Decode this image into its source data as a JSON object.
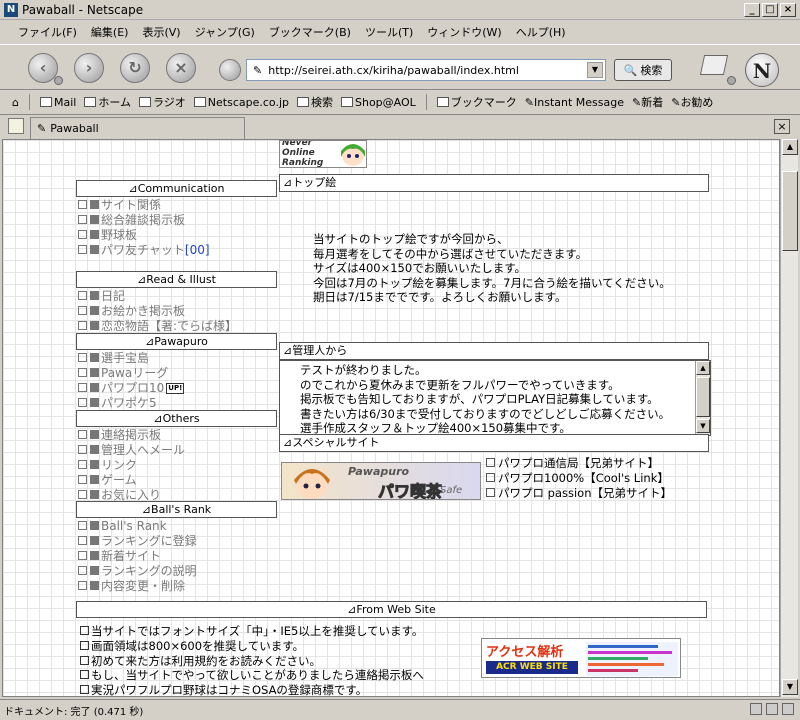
{
  "window": {
    "title": "Pawaball - Netscape",
    "app_icon": "N",
    "buttons": [
      "_",
      "□",
      "×"
    ]
  },
  "menu": [
    "ファイル(F)",
    "編集(E)",
    "表示(V)",
    "ジャンプ(G)",
    "ブックマーク(B)",
    "ツール(T)",
    "ウィンドウ(W)",
    "ヘルプ(H)"
  ],
  "nav": {
    "url": "http://seirei.ath.cx/kiriha/pawaball/index.html",
    "search_label": "検索",
    "logo": "N"
  },
  "personal_toolbar": [
    "Mail",
    "ホーム",
    "ラジオ",
    "Netscape.co.jp",
    "検索",
    "Shop@AOL",
    "ブックマーク",
    "Instant Message",
    "新着",
    "お勧め"
  ],
  "tab": {
    "label": "Pawaball",
    "close": "×"
  },
  "page": {
    "ranking_banner": {
      "line1": "Never",
      "line2": "Online",
      "line3": "Ranking"
    },
    "sections": {
      "communication": "⊿Communication",
      "read_illust": "⊿Read & Illust",
      "pawapuro": "⊿Pawapuro",
      "others": "⊿Others",
      "balls_rank": "⊿Ball's Rank",
      "from_web": "⊿From Web Site",
      "top_e": "⊿トップ絵",
      "admin": "⊿管理人から",
      "special": "⊿スペシャルサイト"
    },
    "communication_items": [
      "サイト関係",
      "総合雑談掲示板",
      "野球板",
      "パワ友チャット"
    ],
    "chat_suffix": "[00]",
    "read_items": [
      "日記",
      "お絵かき掲示板",
      "恋恋物語【著:でらば様】"
    ],
    "pawapuro_items": [
      "選手宝島",
      "Pawaリーグ",
      "パワプロ10",
      "パワポケ5"
    ],
    "up_badge": "UP!",
    "others_items": [
      "連絡掲示板",
      "管理人へメール",
      "リンク",
      "ゲーム",
      "お気に入り"
    ],
    "rank_items": [
      "Ball's Rank",
      "ランキングに登録",
      "新着サイト",
      "ランキングの説明",
      "内容変更・削除"
    ],
    "top_text": [
      "当サイトのトップ絵ですが今回から、",
      "毎月選考をしてその中から選ばさせていただきます。",
      "サイズは400×150でお願いいたします。",
      "今回は7月のトップ絵を募集します。7月に合う絵を描いてください。",
      "期日は7/15まででです。よろしくお願いします。"
    ],
    "admin_text": [
      "テストが終わりました。",
      "のでこれから夏休みまで更新をフルパワーでやっていきます。",
      "掲示板でも告知しておりますが、パワプロPLAY日記募集しています。",
      "書きたい方は6/30まで受付しておりますのでどしどしご応募ください。",
      "選手作成スタッフ＆トップ絵400×150募集中です。"
    ],
    "special_banner": {
      "title": "Pawapuro",
      "sub": "パワ喫茶",
      "tag": "Safe"
    },
    "sister_sites": [
      "パワプロ通信局【兄弟サイト】",
      "パワプロ1000%【Cool's Link】",
      "パワプロ passion【兄弟サイト】"
    ],
    "footer": [
      "当サイトではフォントサイズ「中」・IE5以上を推奨しています。",
      "画面領域は800×600を推奨しています。",
      "初めて来た方は利用規約をお読みください。",
      "もし、当サイトでやって欲しいことがありましたら連絡掲示板へ",
      "実況パワフルプロ野球はコナミOSAの登録商標です。"
    ],
    "access_banner": {
      "title": "アクセス解析",
      "sub": "ACR WEB SITE"
    }
  },
  "status": {
    "text": "ドキュメント: 完了 (0.471 秒)"
  },
  "colors": {
    "chrome": "#d4d0c8",
    "link_gray": "#7a7a7a",
    "accent_blue": "#2244cc"
  }
}
